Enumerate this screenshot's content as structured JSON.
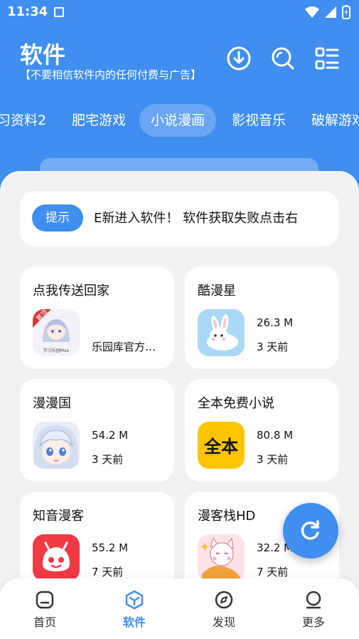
{
  "status_bar": {
    "time": "11:34"
  },
  "header": {
    "title": "软件",
    "subtitle": "【不要相信软件内的任何付费与广告】",
    "icons": [
      "download-icon",
      "search-icon",
      "list-menu-icon"
    ]
  },
  "tabs": [
    "习资料2",
    "肥宅游戏",
    "小说漫画",
    "影视音乐",
    "破解游戏"
  ],
  "active_tab": "小说漫画",
  "notice": {
    "badge": "提示",
    "text": "E新进入软件！   软件获取失败点击右"
  },
  "apps": [
    {
      "name": "点我传送回家",
      "source": "乐园库官方…",
      "icon": "home-portal-icon"
    },
    {
      "name": "酷漫星",
      "size": "26.3 M",
      "age": "3 天前",
      "icon": "rabbit-icon"
    },
    {
      "name": "漫漫国",
      "size": "54.2 M",
      "age": "3 天前",
      "icon": "anime-girl-icon"
    },
    {
      "name": "全本免费小说",
      "size": "80.8 M",
      "age": "3 天前",
      "icon": "quanben-icon",
      "icon_text": "全本"
    },
    {
      "name": "知音漫客",
      "size": "55.2 M",
      "age": "7 天前",
      "icon": "zhiyin-icon"
    },
    {
      "name": "漫客栈HD",
      "size": "32.2 M",
      "age": "7 天前",
      "icon": "cat-icon"
    }
  ],
  "home_card_badge": "置顶",
  "home_card_caption": "学习乐园Max",
  "bottom_nav": [
    {
      "label": "首页",
      "icon": "home-icon"
    },
    {
      "label": "软件",
      "icon": "software-icon",
      "active": true
    },
    {
      "label": "发现",
      "icon": "compass-icon"
    },
    {
      "label": "更多",
      "icon": "more-icon"
    }
  ],
  "colors": {
    "primary": "#3f8ef0",
    "background": "#f2f2f4"
  }
}
